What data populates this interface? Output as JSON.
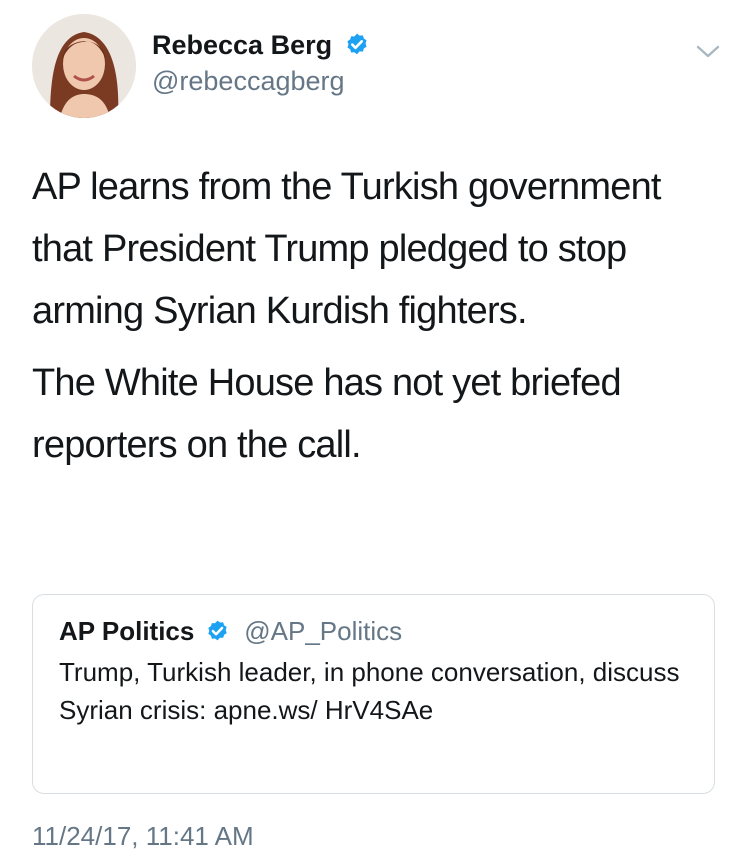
{
  "author": {
    "display_name": "Rebecca Berg",
    "handle": "@rebeccagberg",
    "verified": true
  },
  "tweet": {
    "paragraphs": [
      "AP learns from the Turkish government that President Trump pledged to stop arming Syrian Kurdish fighters.",
      "The White House has not yet briefed reporters on the call."
    ]
  },
  "quoted_tweet": {
    "display_name": "AP Politics",
    "handle": "@AP_Politics",
    "verified": true,
    "text": "Trump, Turkish leader, in phone conversation, discuss Syrian crisis: apne.ws/ HrV4SAe"
  },
  "timestamp": "11/24/17, 11:41 AM",
  "icons": {
    "verified": "verified-badge-icon",
    "menu": "chevron-down-icon"
  },
  "colors": {
    "verified_blue": "#1da1f2",
    "secondary_text": "#657786",
    "border": "#d8dee3"
  }
}
